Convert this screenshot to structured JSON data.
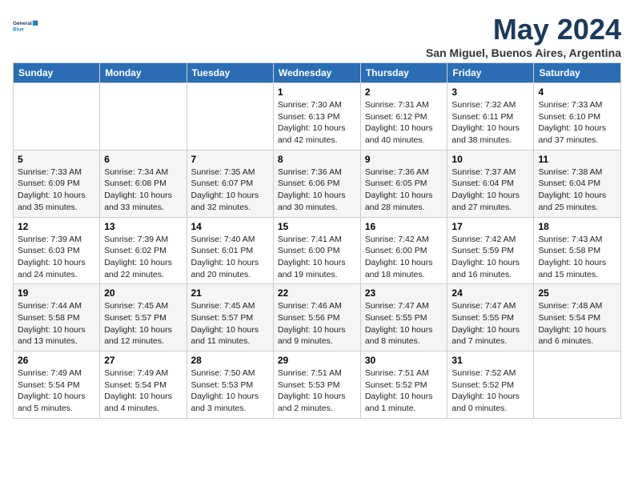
{
  "logo": {
    "line1": "General",
    "line2": "Blue"
  },
  "title": "May 2024",
  "subtitle": "San Miguel, Buenos Aires, Argentina",
  "days_header": [
    "Sunday",
    "Monday",
    "Tuesday",
    "Wednesday",
    "Thursday",
    "Friday",
    "Saturday"
  ],
  "weeks": [
    [
      {
        "num": "",
        "info": ""
      },
      {
        "num": "",
        "info": ""
      },
      {
        "num": "",
        "info": ""
      },
      {
        "num": "1",
        "info": "Sunrise: 7:30 AM\nSunset: 6:13 PM\nDaylight: 10 hours\nand 42 minutes."
      },
      {
        "num": "2",
        "info": "Sunrise: 7:31 AM\nSunset: 6:12 PM\nDaylight: 10 hours\nand 40 minutes."
      },
      {
        "num": "3",
        "info": "Sunrise: 7:32 AM\nSunset: 6:11 PM\nDaylight: 10 hours\nand 38 minutes."
      },
      {
        "num": "4",
        "info": "Sunrise: 7:33 AM\nSunset: 6:10 PM\nDaylight: 10 hours\nand 37 minutes."
      }
    ],
    [
      {
        "num": "5",
        "info": "Sunrise: 7:33 AM\nSunset: 6:09 PM\nDaylight: 10 hours\nand 35 minutes."
      },
      {
        "num": "6",
        "info": "Sunrise: 7:34 AM\nSunset: 6:08 PM\nDaylight: 10 hours\nand 33 minutes."
      },
      {
        "num": "7",
        "info": "Sunrise: 7:35 AM\nSunset: 6:07 PM\nDaylight: 10 hours\nand 32 minutes."
      },
      {
        "num": "8",
        "info": "Sunrise: 7:36 AM\nSunset: 6:06 PM\nDaylight: 10 hours\nand 30 minutes."
      },
      {
        "num": "9",
        "info": "Sunrise: 7:36 AM\nSunset: 6:05 PM\nDaylight: 10 hours\nand 28 minutes."
      },
      {
        "num": "10",
        "info": "Sunrise: 7:37 AM\nSunset: 6:04 PM\nDaylight: 10 hours\nand 27 minutes."
      },
      {
        "num": "11",
        "info": "Sunrise: 7:38 AM\nSunset: 6:04 PM\nDaylight: 10 hours\nand 25 minutes."
      }
    ],
    [
      {
        "num": "12",
        "info": "Sunrise: 7:39 AM\nSunset: 6:03 PM\nDaylight: 10 hours\nand 24 minutes."
      },
      {
        "num": "13",
        "info": "Sunrise: 7:39 AM\nSunset: 6:02 PM\nDaylight: 10 hours\nand 22 minutes."
      },
      {
        "num": "14",
        "info": "Sunrise: 7:40 AM\nSunset: 6:01 PM\nDaylight: 10 hours\nand 20 minutes."
      },
      {
        "num": "15",
        "info": "Sunrise: 7:41 AM\nSunset: 6:00 PM\nDaylight: 10 hours\nand 19 minutes."
      },
      {
        "num": "16",
        "info": "Sunrise: 7:42 AM\nSunset: 6:00 PM\nDaylight: 10 hours\nand 18 minutes."
      },
      {
        "num": "17",
        "info": "Sunrise: 7:42 AM\nSunset: 5:59 PM\nDaylight: 10 hours\nand 16 minutes."
      },
      {
        "num": "18",
        "info": "Sunrise: 7:43 AM\nSunset: 5:58 PM\nDaylight: 10 hours\nand 15 minutes."
      }
    ],
    [
      {
        "num": "19",
        "info": "Sunrise: 7:44 AM\nSunset: 5:58 PM\nDaylight: 10 hours\nand 13 minutes."
      },
      {
        "num": "20",
        "info": "Sunrise: 7:45 AM\nSunset: 5:57 PM\nDaylight: 10 hours\nand 12 minutes."
      },
      {
        "num": "21",
        "info": "Sunrise: 7:45 AM\nSunset: 5:57 PM\nDaylight: 10 hours\nand 11 minutes."
      },
      {
        "num": "22",
        "info": "Sunrise: 7:46 AM\nSunset: 5:56 PM\nDaylight: 10 hours\nand 9 minutes."
      },
      {
        "num": "23",
        "info": "Sunrise: 7:47 AM\nSunset: 5:55 PM\nDaylight: 10 hours\nand 8 minutes."
      },
      {
        "num": "24",
        "info": "Sunrise: 7:47 AM\nSunset: 5:55 PM\nDaylight: 10 hours\nand 7 minutes."
      },
      {
        "num": "25",
        "info": "Sunrise: 7:48 AM\nSunset: 5:54 PM\nDaylight: 10 hours\nand 6 minutes."
      }
    ],
    [
      {
        "num": "26",
        "info": "Sunrise: 7:49 AM\nSunset: 5:54 PM\nDaylight: 10 hours\nand 5 minutes."
      },
      {
        "num": "27",
        "info": "Sunrise: 7:49 AM\nSunset: 5:54 PM\nDaylight: 10 hours\nand 4 minutes."
      },
      {
        "num": "28",
        "info": "Sunrise: 7:50 AM\nSunset: 5:53 PM\nDaylight: 10 hours\nand 3 minutes."
      },
      {
        "num": "29",
        "info": "Sunrise: 7:51 AM\nSunset: 5:53 PM\nDaylight: 10 hours\nand 2 minutes."
      },
      {
        "num": "30",
        "info": "Sunrise: 7:51 AM\nSunset: 5:52 PM\nDaylight: 10 hours\nand 1 minute."
      },
      {
        "num": "31",
        "info": "Sunrise: 7:52 AM\nSunset: 5:52 PM\nDaylight: 10 hours\nand 0 minutes."
      },
      {
        "num": "",
        "info": ""
      }
    ]
  ]
}
